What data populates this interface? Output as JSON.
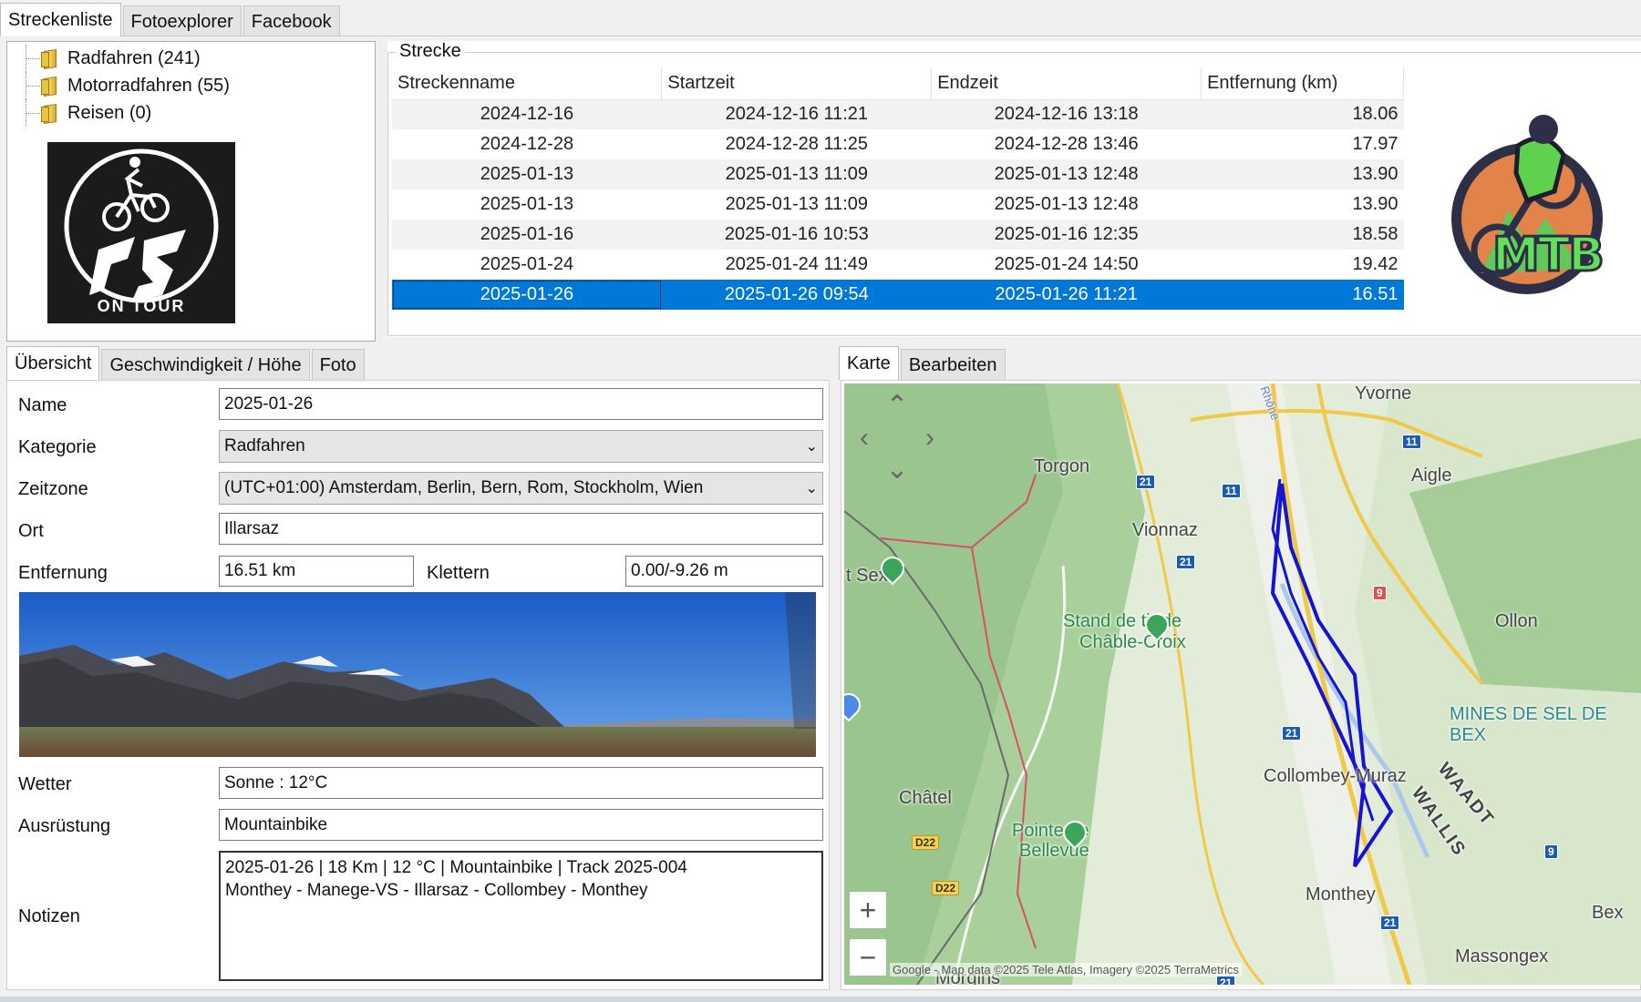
{
  "main_tabs": [
    "Streckenliste",
    "Fotoexplorer",
    "Facebook"
  ],
  "tree": [
    {
      "label": "Radfahren (241)"
    },
    {
      "label": "Motorradfahren (55)"
    },
    {
      "label": "Reisen (0)"
    }
  ],
  "logo_left": {
    "text": "ON TOUR",
    "initials": "FS"
  },
  "strecke": {
    "group_title": "Strecke",
    "columns": [
      "Streckenname",
      "Startzeit",
      "Endzeit",
      "Entfernung (km)"
    ],
    "rows": [
      [
        "2024-12-16",
        "2024-12-16 11:21",
        "2024-12-16 13:18",
        "18.06"
      ],
      [
        "2024-12-28",
        "2024-12-28 11:25",
        "2024-12-28 13:46",
        "17.97"
      ],
      [
        "2025-01-13",
        "2025-01-13 11:09",
        "2025-01-13 12:48",
        "13.90"
      ],
      [
        "2025-01-13",
        "2025-01-13 11:09",
        "2025-01-13 12:48",
        "13.90"
      ],
      [
        "2025-01-16",
        "2025-01-16 10:53",
        "2025-01-16 12:35",
        "18.58"
      ],
      [
        "2025-01-24",
        "2025-01-24 11:49",
        "2025-01-24 14:50",
        "19.42"
      ],
      [
        "2025-01-26",
        "2025-01-26 09:54",
        "2025-01-26 11:21",
        "16.51"
      ]
    ],
    "selected_row": 6
  },
  "logo_right": {
    "text": "MTB"
  },
  "detail_tabs": [
    "Übersicht",
    "Geschwindigkeit / Höhe",
    "Foto"
  ],
  "form": {
    "name_label": "Name",
    "name_value": "2025-01-26",
    "kategorie_label": "Kategorie",
    "kategorie_value": "Radfahren",
    "zeitzone_label": "Zeitzone",
    "zeitzone_value": "(UTC+01:00) Amsterdam, Berlin, Bern, Rom, Stockholm, Wien",
    "ort_label": "Ort",
    "ort_value": "Illarsaz",
    "entfernung_label": "Entfernung",
    "entfernung_value": "16.51 km",
    "klettern_label": "Klettern",
    "klettern_value": "0.00/-9.26 m",
    "wetter_label": "Wetter",
    "wetter_value": "Sonne :  12°C",
    "ausruestung_label": "Ausrüstung",
    "ausruestung_value": "Mountainbike",
    "notizen_label": "Notizen",
    "notizen_line1": "2025-01-26  |  18 Km  |  12 °C  |  Mountainbike  |  Track 2025-004",
    "notizen_line2": "Monthey - Manege-VS - Illarsaz - Collombey - Monthey"
  },
  "map_tabs": [
    "Karte",
    "Bearbeiten"
  ],
  "map": {
    "places": [
      "Yvorne",
      "Aigle",
      "Torgon",
      "Vionnaz",
      "t Sex",
      "Stand de tir de",
      "Châble-Croix",
      "Ollon",
      "MINES DE SEL DE BEX",
      "Collombey-Muraz",
      "WAADT",
      "WALLIS",
      "Châtel",
      "Pointe de",
      "Bellevue",
      "Monthey",
      "Bex",
      "Massongex",
      "Morgins",
      "Rhône"
    ],
    "routes": [
      "11",
      "21",
      "11",
      "21",
      "9",
      "21",
      "21",
      "9",
      "21",
      "D22",
      "D22"
    ],
    "attribution": "Google - Map data ©2025 Tele Atlas, Imagery ©2025 TerraMetrics",
    "zoom_in": "+",
    "zoom_out": "−"
  },
  "colors": {
    "selection": "#0078d7",
    "track": "#1414d2",
    "marker": "#3ca55c"
  }
}
